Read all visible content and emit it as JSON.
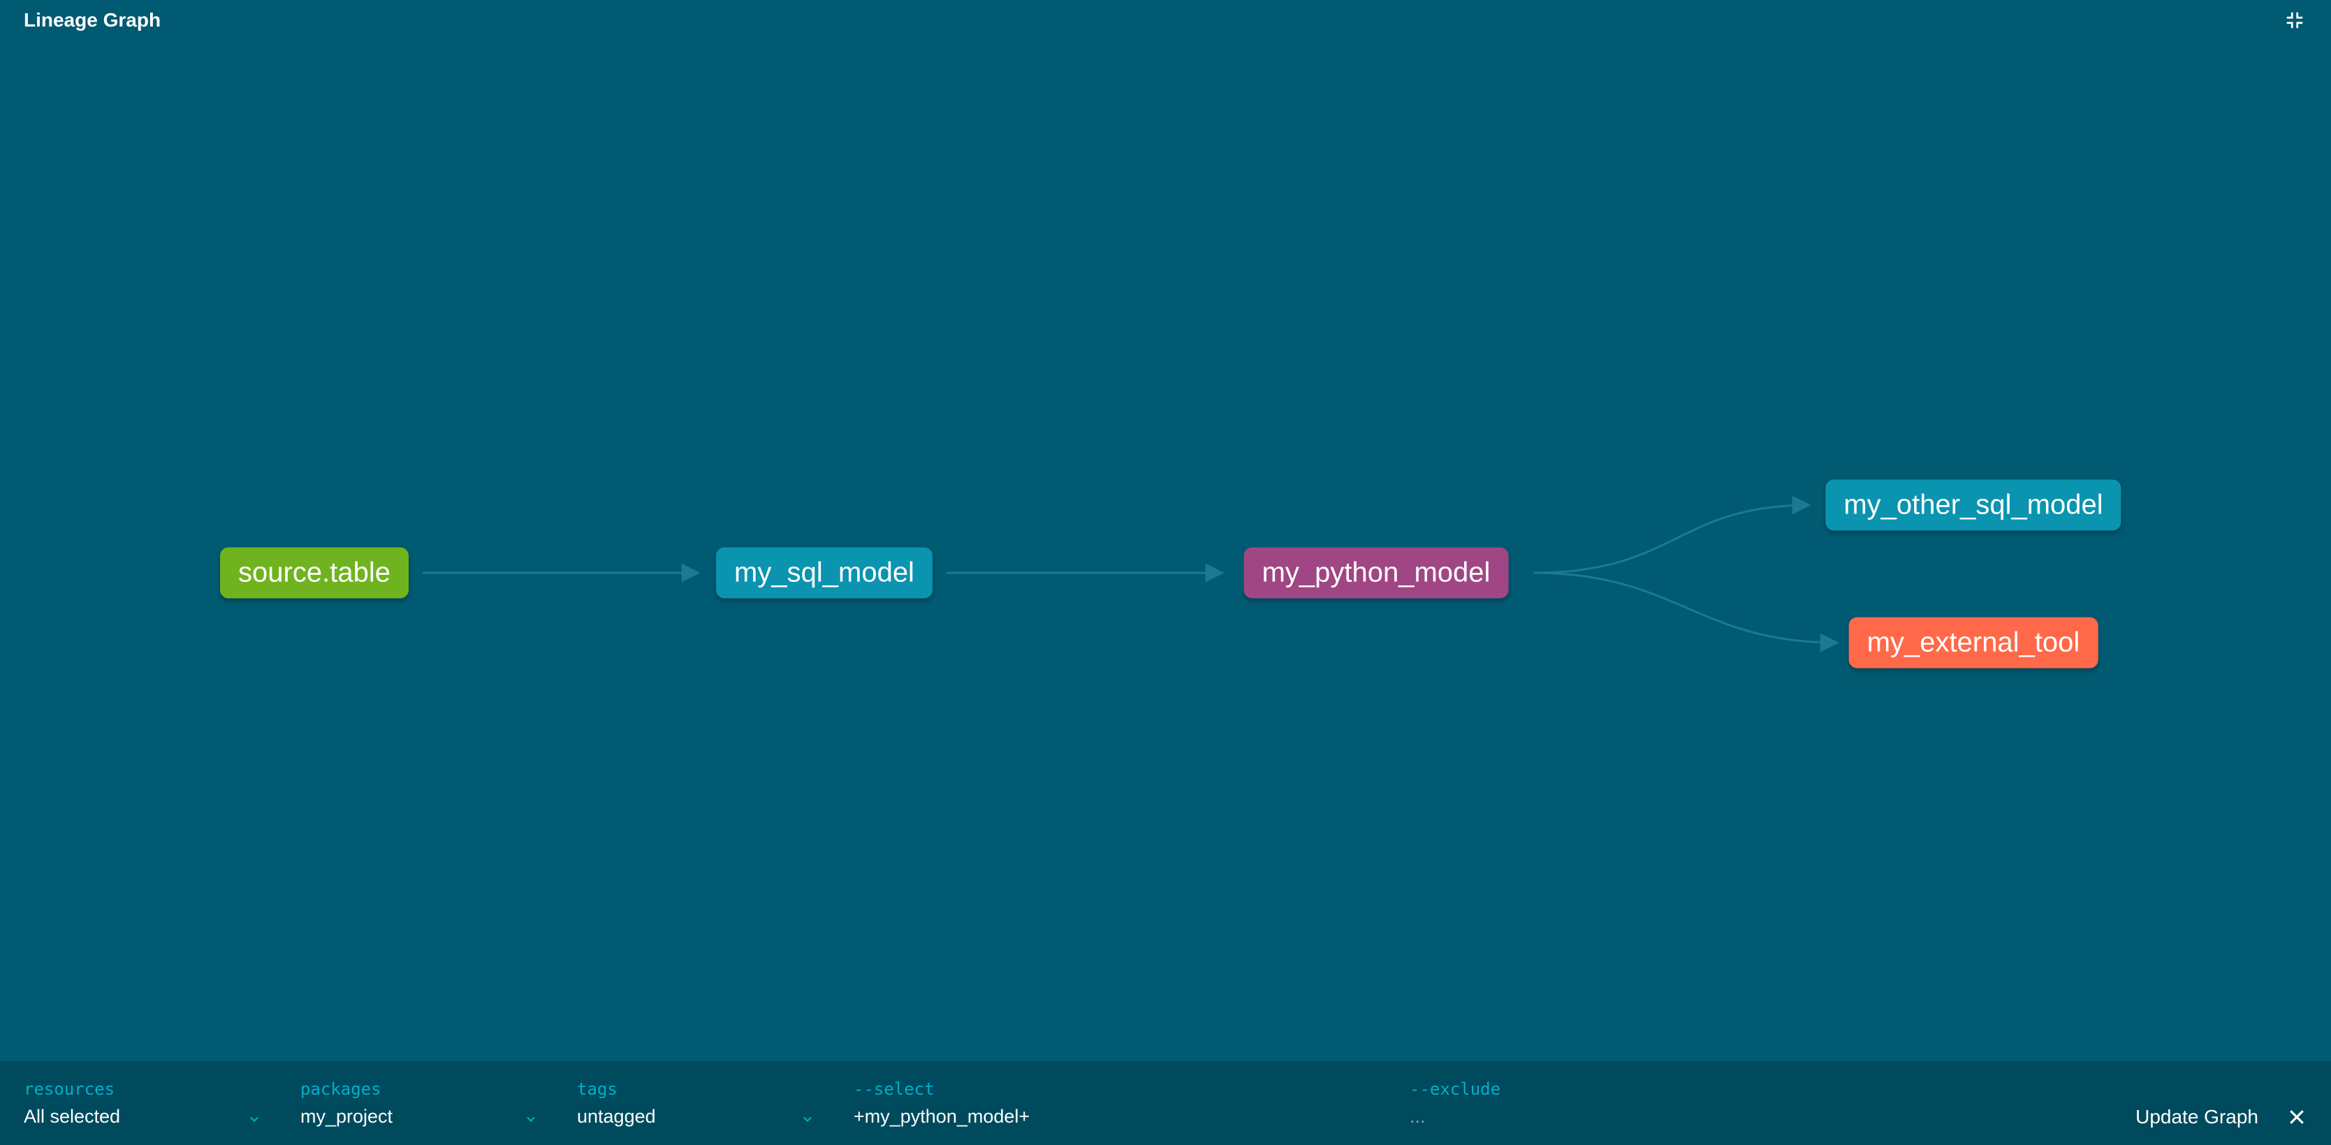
{
  "header": {
    "title": "Lineage Graph"
  },
  "nodes": {
    "source_table": {
      "label": "source.table",
      "color": "#6fb41f"
    },
    "my_sql_model": {
      "label": "my_sql_model",
      "color": "#0a94b0"
    },
    "my_python_model": {
      "label": "my_python_model",
      "color": "#a04684"
    },
    "my_other_sql_model": {
      "label": "my_other_sql_model",
      "color": "#0a94b0"
    },
    "my_external_tool": {
      "label": "my_external_tool",
      "color": "#ff694a"
    }
  },
  "footer": {
    "resources": {
      "label": "resources",
      "value": "All selected"
    },
    "packages": {
      "label": "packages",
      "value": "my_project"
    },
    "tags": {
      "label": "tags",
      "value": "untagged"
    },
    "select": {
      "label": "--select",
      "value": "+my_python_model+"
    },
    "exclude": {
      "label": "--exclude",
      "value": "..."
    },
    "update": "Update Graph"
  }
}
